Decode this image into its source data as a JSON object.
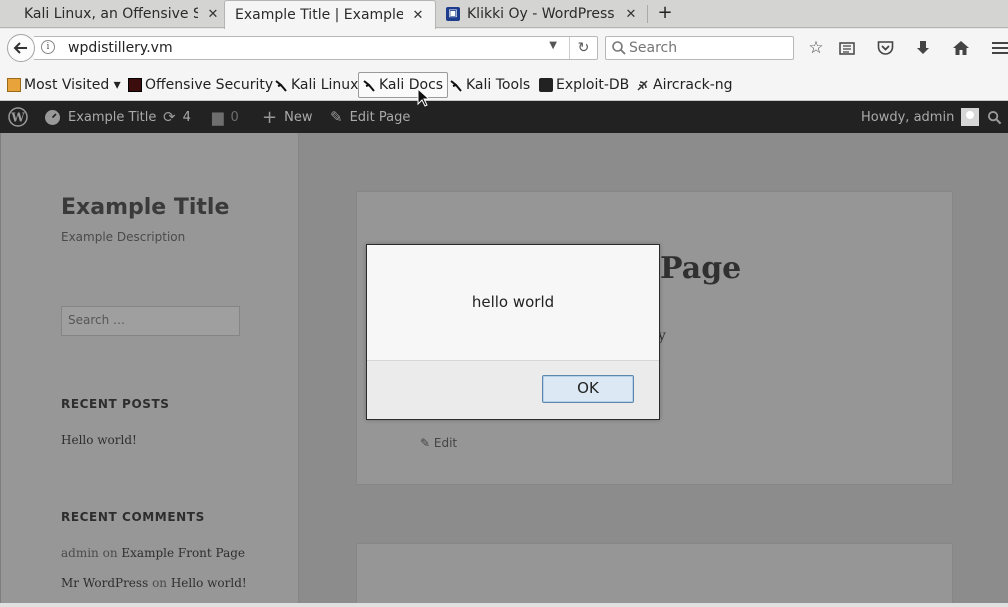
{
  "browser": {
    "tabs": [
      {
        "title": "Kali Linux, an Offensive S...",
        "close": "✕",
        "active": false
      },
      {
        "title": "Example Title | Example ...",
        "close": "✕",
        "active": true
      },
      {
        "title": "Klikki Oy - WordPress...",
        "close": "✕",
        "active": false
      }
    ],
    "new_tab": "+",
    "url": "wpdistillery.vm",
    "search_placeholder": "Search",
    "bookmarks": [
      {
        "label": "Most Visited ▾",
        "icon": "folder-icon"
      },
      {
        "label": "Offensive Security",
        "icon": "offsec-icon"
      },
      {
        "label": "Kali Linux",
        "icon": "kali-dragon-icon"
      },
      {
        "label": "Kali Docs",
        "icon": "kali-dragon-icon"
      },
      {
        "label": "Kali Tools",
        "icon": "kali-dragon-icon"
      },
      {
        "label": "Exploit-DB",
        "icon": "exploitdb-icon"
      },
      {
        "label": "Aircrack-ng",
        "icon": "aircrack-icon"
      }
    ]
  },
  "adminbar": {
    "site_name": "Example Title",
    "updates_count": "4",
    "comments_count": "0",
    "new_label": "New",
    "edit_label": "Edit Page",
    "howdy": "Howdy, admin"
  },
  "site": {
    "title": "Example Title",
    "description": "Example Description",
    "search_placeholder": "Search …",
    "recent_posts_title": "RECENT POSTS",
    "recent_posts": [
      "Hello world!"
    ],
    "recent_comments_title": "RECENT COMMENTS",
    "recent_comments": [
      {
        "author": "admin",
        "on": "on",
        "post": "Example Front Page"
      },
      {
        "author": "Mr WordPress",
        "on": "on",
        "post": "Hello world!"
      }
    ],
    "page_title_partial": "Page",
    "page_text_partial": "y",
    "edit_link": "Edit"
  },
  "dialog": {
    "message": "hello world",
    "ok_label": "OK"
  }
}
